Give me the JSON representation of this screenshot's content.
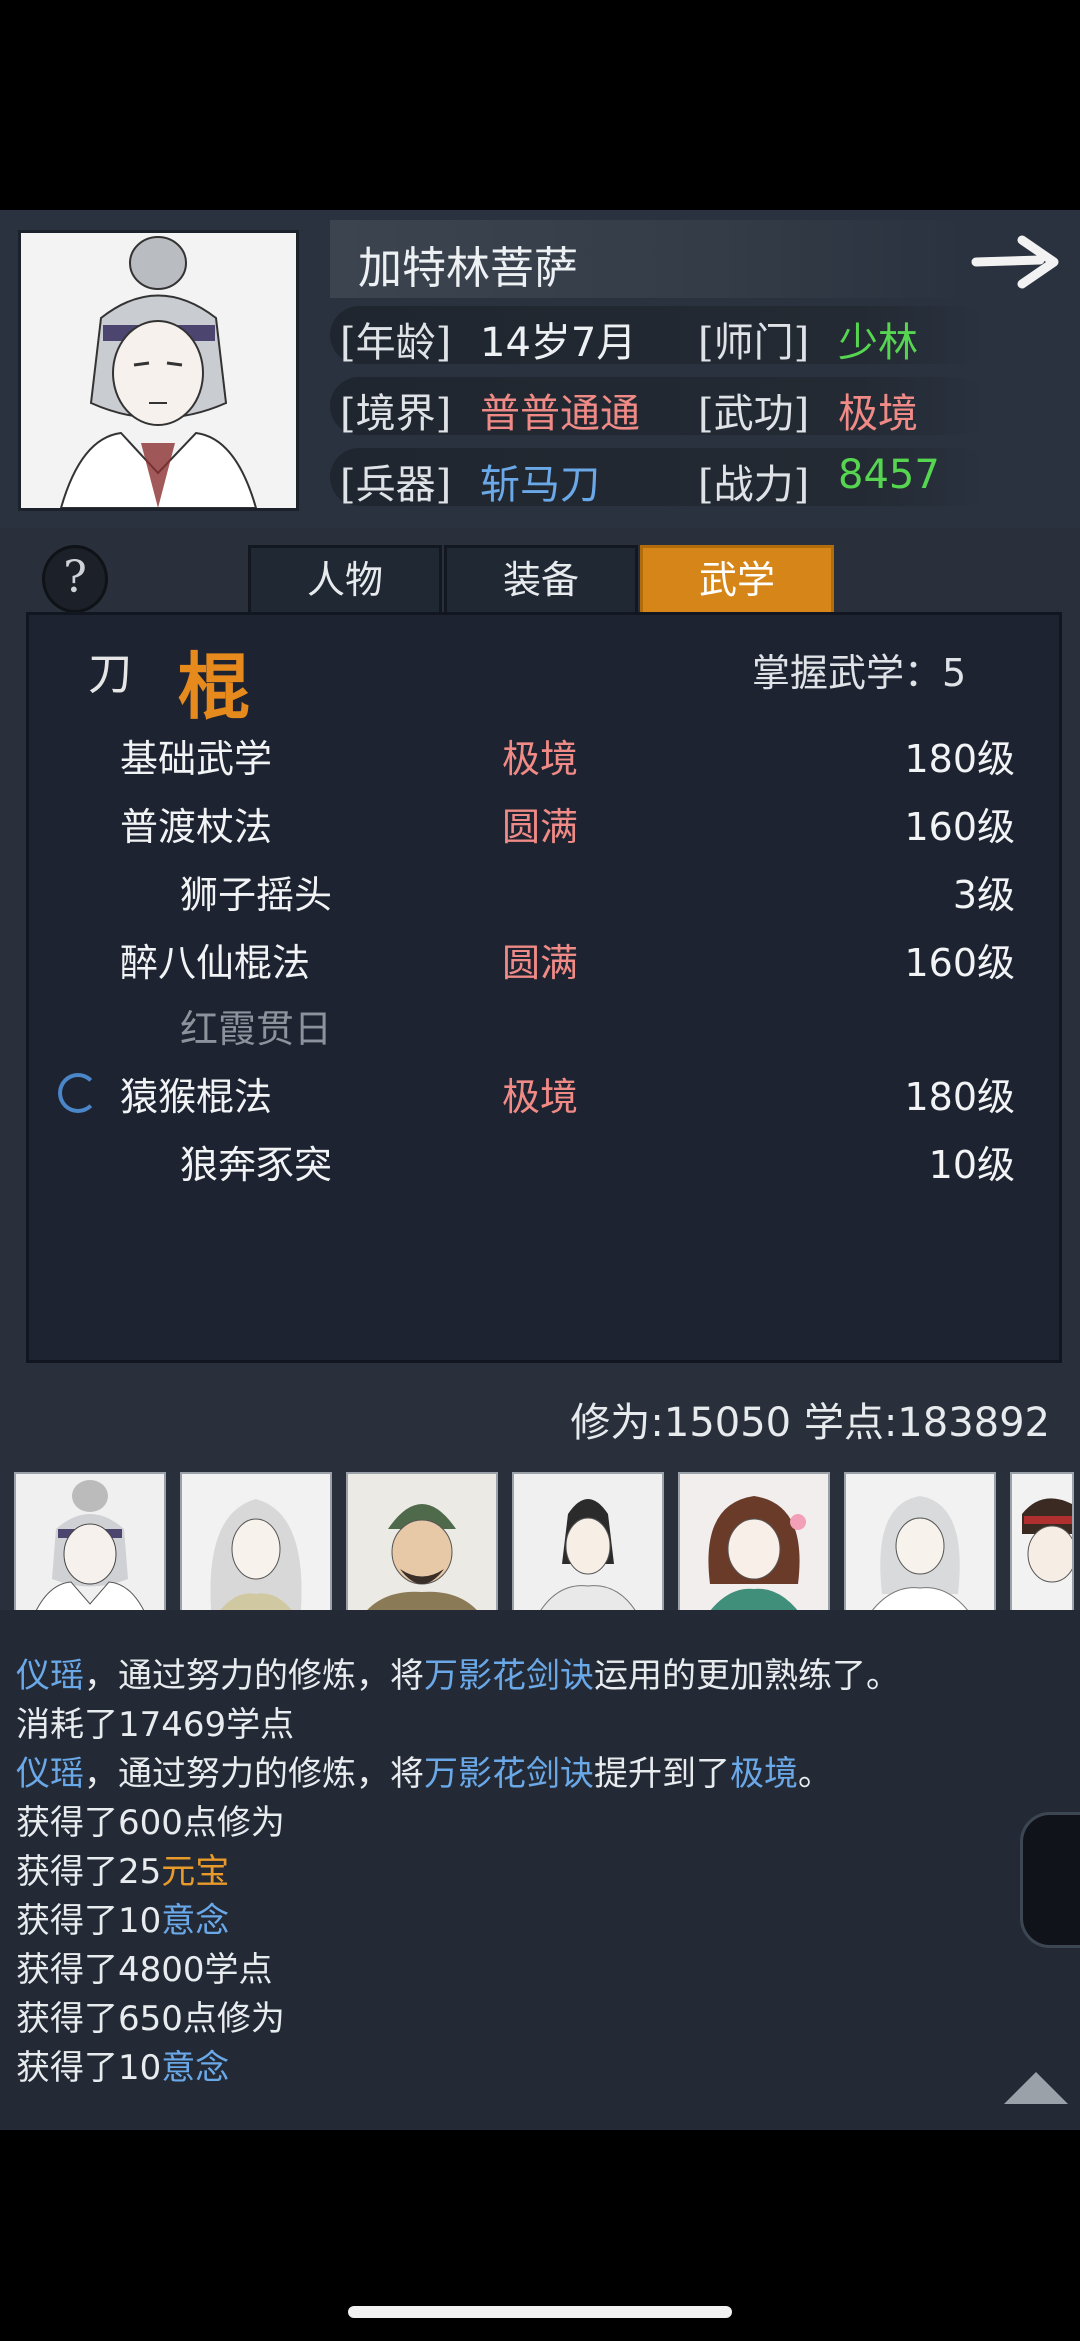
{
  "character": {
    "name": "加特林菩萨",
    "fields": [
      {
        "label": "[年龄]",
        "value": "14岁7月",
        "color": "#eef1f4"
      },
      {
        "label": "[师门]",
        "value": "少林",
        "color": "#56d650"
      },
      {
        "label": "[境界]",
        "value": "普普通通",
        "color": "#f08a86"
      },
      {
        "label": "[武功]",
        "value": "极境",
        "color": "#f08a86"
      },
      {
        "label": "[兵器]",
        "value": "斩马刀",
        "color": "#6aa8e8"
      },
      {
        "label": "[战力]",
        "value": "8457",
        "color": "#56d650"
      }
    ]
  },
  "tabs": [
    "人物",
    "装备",
    "武学"
  ],
  "active_tab": "武学",
  "help_label": "?",
  "categories": {
    "secondary": "刀",
    "active": "棍"
  },
  "mastery_label": "掌握武学：5",
  "skills": [
    {
      "name": "基础武学",
      "rank": "极境",
      "level": "180级"
    },
    {
      "name": "普渡杖法",
      "rank": "圆满",
      "level": "160级"
    },
    {
      "name": "狮子摇头",
      "rank": "",
      "level": "3级"
    },
    {
      "name": "醉八仙棍法",
      "rank": "圆满",
      "level": "160级"
    },
    {
      "name": "红霞贯日",
      "rank": "",
      "level": ""
    },
    {
      "name": "猿猴棍法",
      "rank": "极境",
      "level": "180级"
    },
    {
      "name": "狼奔豕突",
      "rank": "",
      "level": "10级"
    }
  ],
  "stats": "修为:15050 学点:183892",
  "log": {
    "line1": {
      "a": "仪瑶",
      "b": "，通过努力的修炼，将",
      "c": "万影花剑诀",
      "d": "运用的更加熟练了。"
    },
    "line2": "消耗了17469学点",
    "line3": {
      "a": "仪瑶",
      "b": "，通过努力的修炼，将",
      "c": "万影花剑诀",
      "d": "提升到了",
      "e": "极境",
      "f": "。"
    },
    "line4": "获得了600点修为",
    "line5": {
      "a": "获得了25",
      "b": "元宝"
    },
    "line6": {
      "a": "获得了10",
      "b": "意念"
    },
    "line7": "获得了4800学点",
    "line8": "获得了650点修为",
    "line9": {
      "a": "获得了10",
      "b": "意念"
    }
  },
  "colors": {
    "accent": "#d68618",
    "green": "#56d650",
    "red": "#f08a86",
    "blue": "#6aa8e8"
  }
}
